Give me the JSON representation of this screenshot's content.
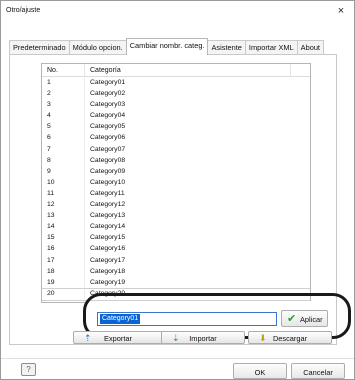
{
  "window": {
    "title": "Otro/ajuste",
    "close_glyph": "×"
  },
  "tabs": [
    {
      "label": "Predeterminado"
    },
    {
      "label": "Módulo opcion."
    },
    {
      "label": "Cambiar nombr. categ."
    },
    {
      "label": "Asistente"
    },
    {
      "label": "Importar XML"
    },
    {
      "label": "About"
    }
  ],
  "list": {
    "col_no": "No.",
    "col_cat": "Categoría",
    "rows": [
      {
        "no": "1",
        "cat": "Category01"
      },
      {
        "no": "2",
        "cat": "Category02"
      },
      {
        "no": "3",
        "cat": "Category03"
      },
      {
        "no": "4",
        "cat": "Category04"
      },
      {
        "no": "5",
        "cat": "Category05"
      },
      {
        "no": "6",
        "cat": "Category06"
      },
      {
        "no": "7",
        "cat": "Category07"
      },
      {
        "no": "8",
        "cat": "Category08"
      },
      {
        "no": "9",
        "cat": "Category09"
      },
      {
        "no": "10",
        "cat": "Category10"
      },
      {
        "no": "11",
        "cat": "Category11"
      },
      {
        "no": "12",
        "cat": "Category12"
      },
      {
        "no": "13",
        "cat": "Category13"
      },
      {
        "no": "14",
        "cat": "Category14"
      },
      {
        "no": "15",
        "cat": "Category15"
      },
      {
        "no": "16",
        "cat": "Category16"
      },
      {
        "no": "17",
        "cat": "Category17"
      },
      {
        "no": "18",
        "cat": "Category18"
      },
      {
        "no": "19",
        "cat": "Category19"
      },
      {
        "no": "20",
        "cat": "Category20"
      }
    ]
  },
  "edit": {
    "value": "Category01",
    "apply_label": "Aplicar",
    "apply_icon": "checkmark-icon"
  },
  "actions": {
    "export_label": "Exportar",
    "import_label": "Importar",
    "download_label": "Descargar",
    "export_icon": "export-icon",
    "import_icon": "import-icon",
    "download_icon": "download-icon"
  },
  "footer": {
    "ok_label": "OK",
    "cancel_label": "Cancelar",
    "help_icon": "help-icon"
  },
  "colors": {
    "selection": "#0a64d6",
    "apply_check": "#2e9c2e",
    "highlight_ring": "#1a1a1a"
  }
}
